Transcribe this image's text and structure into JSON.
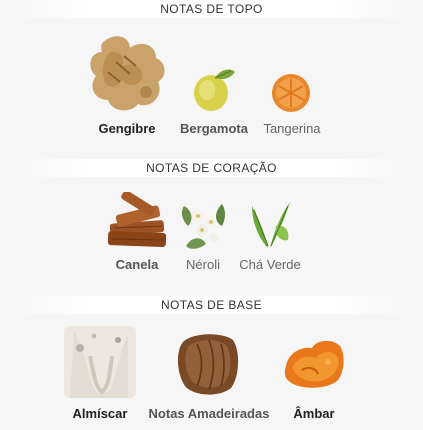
{
  "sections": [
    {
      "title": "NOTAS DE TOPO",
      "notes": [
        {
          "label": "Gengibre",
          "icon": "ginger-icon"
        },
        {
          "label": "Bergamota",
          "icon": "bergamot-icon"
        },
        {
          "label": "Tangerina",
          "icon": "tangerine-icon"
        }
      ]
    },
    {
      "title": "NOTAS DE CORAÇÃO",
      "notes": [
        {
          "label": "Canela",
          "icon": "cinnamon-icon"
        },
        {
          "label": "Néroli",
          "icon": "neroli-icon"
        },
        {
          "label": "Chá Verde",
          "icon": "green-tea-icon"
        }
      ]
    },
    {
      "title": "NOTAS DE BASE",
      "notes": [
        {
          "label": "Almíscar",
          "icon": "musk-icon"
        },
        {
          "label": "Notas Amadeiradas",
          "icon": "woody-notes-icon"
        },
        {
          "label": "Âmbar",
          "icon": "amber-icon"
        }
      ]
    }
  ]
}
